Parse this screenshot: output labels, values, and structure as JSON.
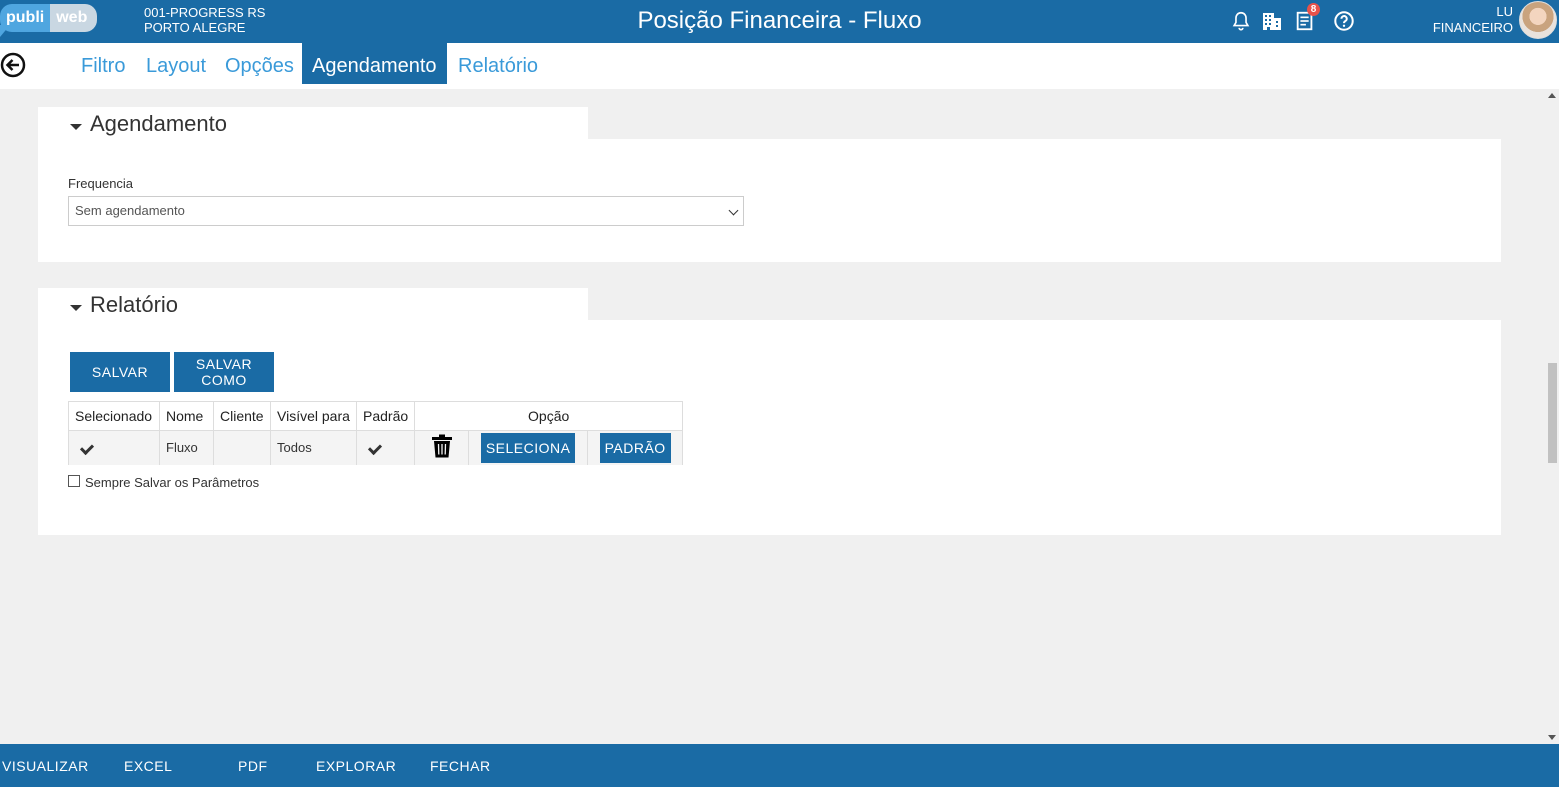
{
  "header": {
    "logo_part1": "publi",
    "logo_part2": "web",
    "company_line1": "001-PROGRESS RS",
    "company_line2": "PORTO ALEGRE",
    "title": "Posição Financeira - Fluxo",
    "notification_count": "8",
    "user_name": "LU",
    "user_role": "FINANCEIRO",
    "icons": [
      "bell-icon",
      "building-icon",
      "document-icon",
      "help-icon"
    ]
  },
  "tabs": [
    {
      "label": "Filtro",
      "active": false
    },
    {
      "label": "Layout",
      "active": false
    },
    {
      "label": "Opções",
      "active": false
    },
    {
      "label": "Agendamento",
      "active": true
    },
    {
      "label": "Relatório",
      "active": false
    }
  ],
  "agendamento": {
    "title": "Agendamento",
    "frequencia_label": "Frequencia",
    "frequencia_value": "Sem agendamento"
  },
  "relatorio": {
    "title": "Relatório",
    "save_label": "SALVAR",
    "save_as_line1": "SALVAR",
    "save_as_line2": "COMO",
    "columns": [
      "Selecionado",
      "Nome",
      "Cliente",
      "Visível para",
      "Padrão",
      "Opção"
    ],
    "rows": [
      {
        "selecionado": true,
        "nome": "Fluxo",
        "cliente": "",
        "visivel_para": "Todos",
        "padrao": true,
        "select_label": "SELECIONA",
        "default_label": "PADRÃO"
      }
    ],
    "always_save_label": "Sempre Salvar os Parâmetros",
    "always_save_checked": false
  },
  "footer": {
    "items": [
      "VISUALIZAR",
      "EXCEL",
      "PDF",
      "EXPLORAR",
      "FECHAR"
    ]
  },
  "colors": {
    "primary": "#1a6ba5",
    "tab_text": "#3a9ad9",
    "badge": "#e8524a"
  }
}
